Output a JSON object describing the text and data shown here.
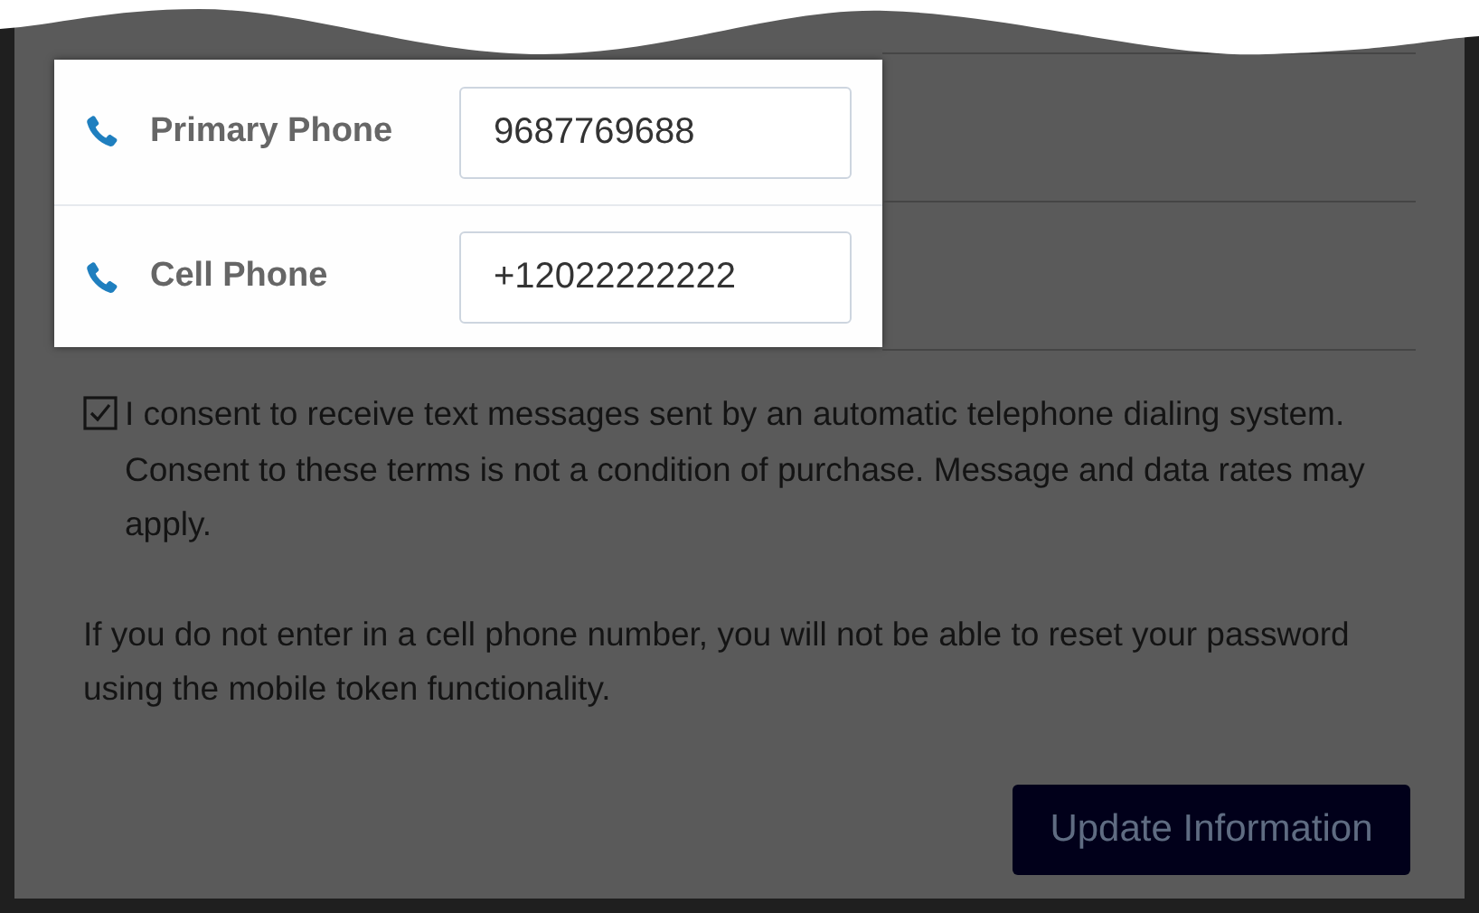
{
  "phones": [
    {
      "label": "Primary Phone",
      "value": "9687769688"
    },
    {
      "label": "Cell Phone",
      "value": "+12022222222"
    }
  ],
  "consent": {
    "checked": true,
    "text": "I consent to receive text messages sent by an automatic telephone dialing system. Consent to these terms is not a condition of purchase. Message and data rates may apply."
  },
  "note": "If you do not enter in a cell phone number, you will not be able to reset your password using the mobile token functionality.",
  "button": "Update Information"
}
